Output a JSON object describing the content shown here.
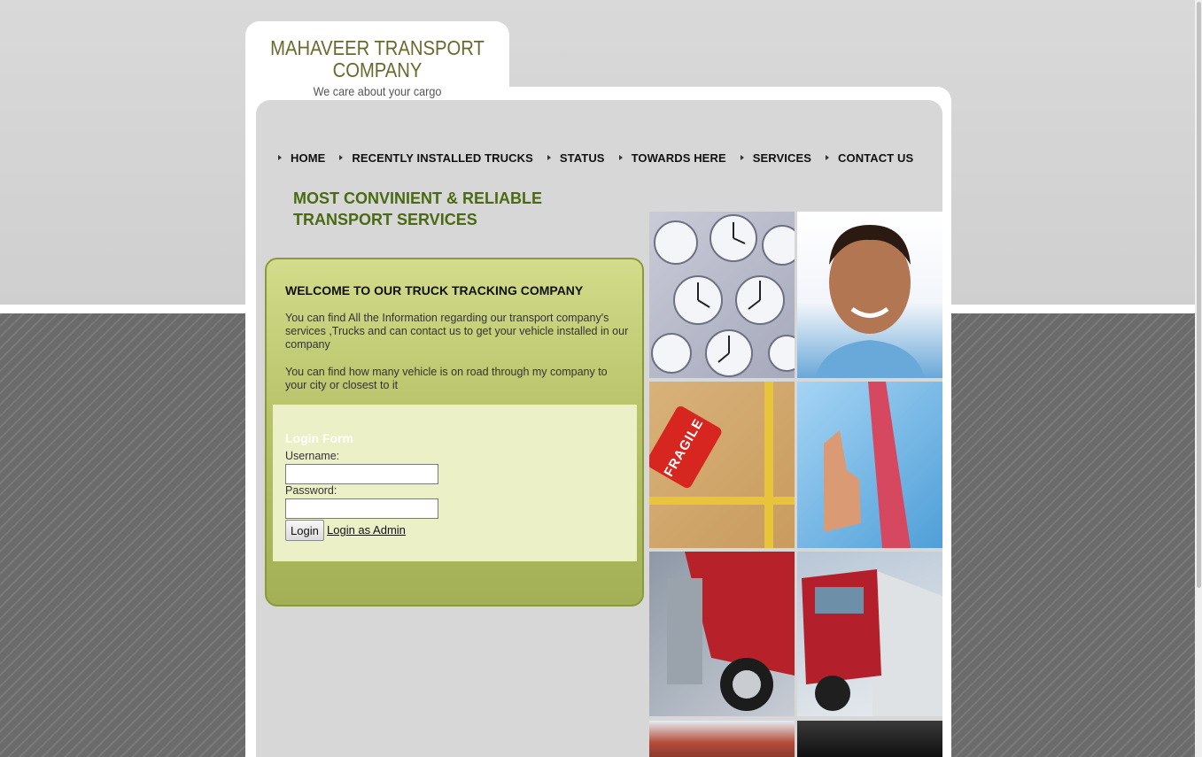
{
  "logo": {
    "title_line1": "MAHAVEER TRANSPORT",
    "title_line2": "COMPANY",
    "tagline": "We care about your cargo"
  },
  "nav": {
    "items": [
      {
        "label": "HOME"
      },
      {
        "label": "RECENTLY INSTALLED TRUCKS"
      },
      {
        "label": "STATUS"
      },
      {
        "label": "TOWARDS HERE"
      },
      {
        "label": "SERVICES"
      },
      {
        "label": "CONTACT US"
      }
    ]
  },
  "headline": {
    "line1": "MOST CONVINIENT & RELIABLE",
    "line2": "TRANSPORT SERVICES"
  },
  "welcome": {
    "heading": "WELCOME TO OUR TRUCK TRACKING COMPANY",
    "paragraph1": "You can find All the Information regarding our transport company's services ,Trucks and can contact us to get your vehicle installed in our company",
    "paragraph2": "You can find how many vehicle is on road through my company to your city or closest to it"
  },
  "login": {
    "title": "Login Form",
    "username_label": "Username:",
    "username_value": "",
    "password_label": "Password:",
    "password_value": "",
    "login_button": "Login",
    "admin_link": "Login as Admin"
  },
  "images": {
    "fragile_label": "FRAGILE"
  },
  "colors": {
    "headline": "#4a6a12",
    "logo": "#69692f",
    "panel": "#b8c36a",
    "login_box": "#ecf0c6"
  }
}
